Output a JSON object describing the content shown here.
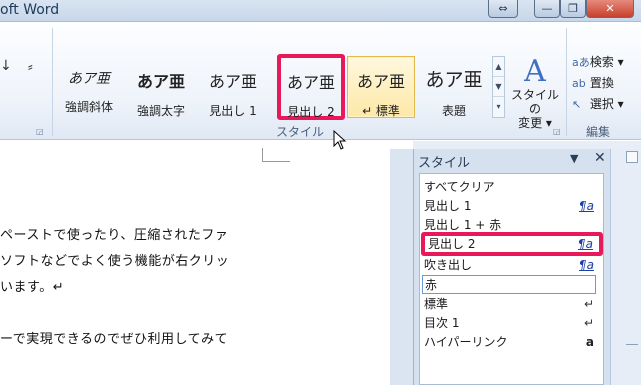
{
  "window": {
    "title": "oft Word",
    "restore_small": "⇔",
    "minimize": "—",
    "maximize": "❐",
    "close": "✕"
  },
  "ribbon": {
    "left_group": {
      "indent_glyph": "↓",
      "sort_glyph": "⸗"
    },
    "styles_group": {
      "label": "スタイル",
      "tiles": [
        {
          "sample": "あア亜",
          "name": "強調斜体"
        },
        {
          "sample": "あア亜",
          "name": "強調太字"
        },
        {
          "sample": "あア亜",
          "name": "見出し 1"
        },
        {
          "sample": "あア亜",
          "name": "見出し 2"
        },
        {
          "sample": "あア亜",
          "name": "↵ 標準"
        },
        {
          "sample": "あア亜",
          "name": "表題"
        }
      ],
      "change_styles": {
        "icon": "A",
        "label_line1": "スタイルの",
        "label_line2": "変更 ▾"
      }
    },
    "editing_group": {
      "label": "編集",
      "items": [
        {
          "icon": "aあ",
          "label": "検索 ▾"
        },
        {
          "icon": "ab",
          "label": "置換"
        },
        {
          "icon": "↖",
          "label": "選択 ▾"
        }
      ]
    }
  },
  "document": {
    "lines": [
      "ペーストで使ったり、圧縮されたファ",
      "ソフトなどでよく使う機能が右クリッ",
      "います。↵",
      "ーで実現できるのでぜひ利用してみて"
    ]
  },
  "styles_pane": {
    "title": "スタイル",
    "menu_arrow": "▼",
    "close": "✕",
    "items": [
      {
        "label": "すべてクリア",
        "mark": ""
      },
      {
        "label": "見出し 1",
        "mark": "¶a"
      },
      {
        "label": "見出し 1 + 赤",
        "mark": ""
      },
      {
        "label": "見出し 2",
        "mark": "¶a"
      },
      {
        "label": "吹き出し",
        "mark": "¶a"
      },
      {
        "label": "赤",
        "mark": ""
      },
      {
        "label": "標準",
        "mark": "↵"
      },
      {
        "label": "目次 1",
        "mark": "↵"
      },
      {
        "label": "ハイパーリンク",
        "mark": "a"
      }
    ]
  },
  "colors": {
    "highlight": "#e8195b",
    "selected_tile": "#fde8a6",
    "ribbon_bg": "#eef3fa",
    "pane_bg": "#d5e1ef"
  }
}
